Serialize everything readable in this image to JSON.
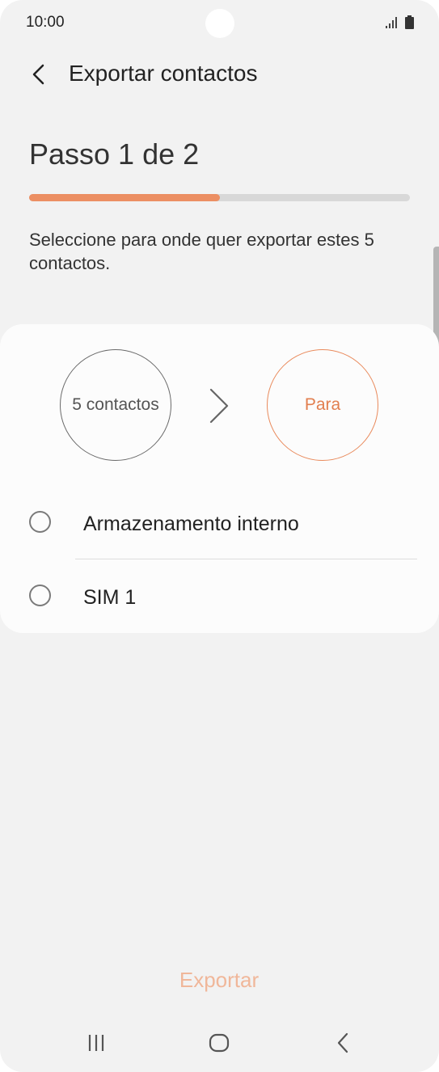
{
  "status_bar": {
    "time": "10:00",
    "icons": [
      "signal-icon",
      "battery-icon"
    ]
  },
  "app_bar": {
    "back_icon": "chevron-left-icon",
    "title": "Exportar contactos"
  },
  "step": {
    "title": "Passo 1 de 2",
    "progress_fraction": 0.5
  },
  "instruction": "Seleccione para onde quer exportar estes 5 contactos.",
  "transfer": {
    "from_label": "5 contactos",
    "arrow_icon": "chevron-right-icon",
    "to_label": "Para"
  },
  "options": [
    {
      "label": "Armazenamento interno",
      "selected": false
    },
    {
      "label": "SIM 1",
      "selected": false
    }
  ],
  "export_button": "Exportar",
  "nav_bar": {
    "recents_icon": "recents-icon",
    "home_icon": "home-icon",
    "back_icon": "back-icon"
  },
  "colors": {
    "accent": "#ec8f63",
    "accent_text": "#e27f4f",
    "disabled_accent": "#f0b79a",
    "background": "#f2f2f2",
    "card": "#fcfcfc"
  }
}
